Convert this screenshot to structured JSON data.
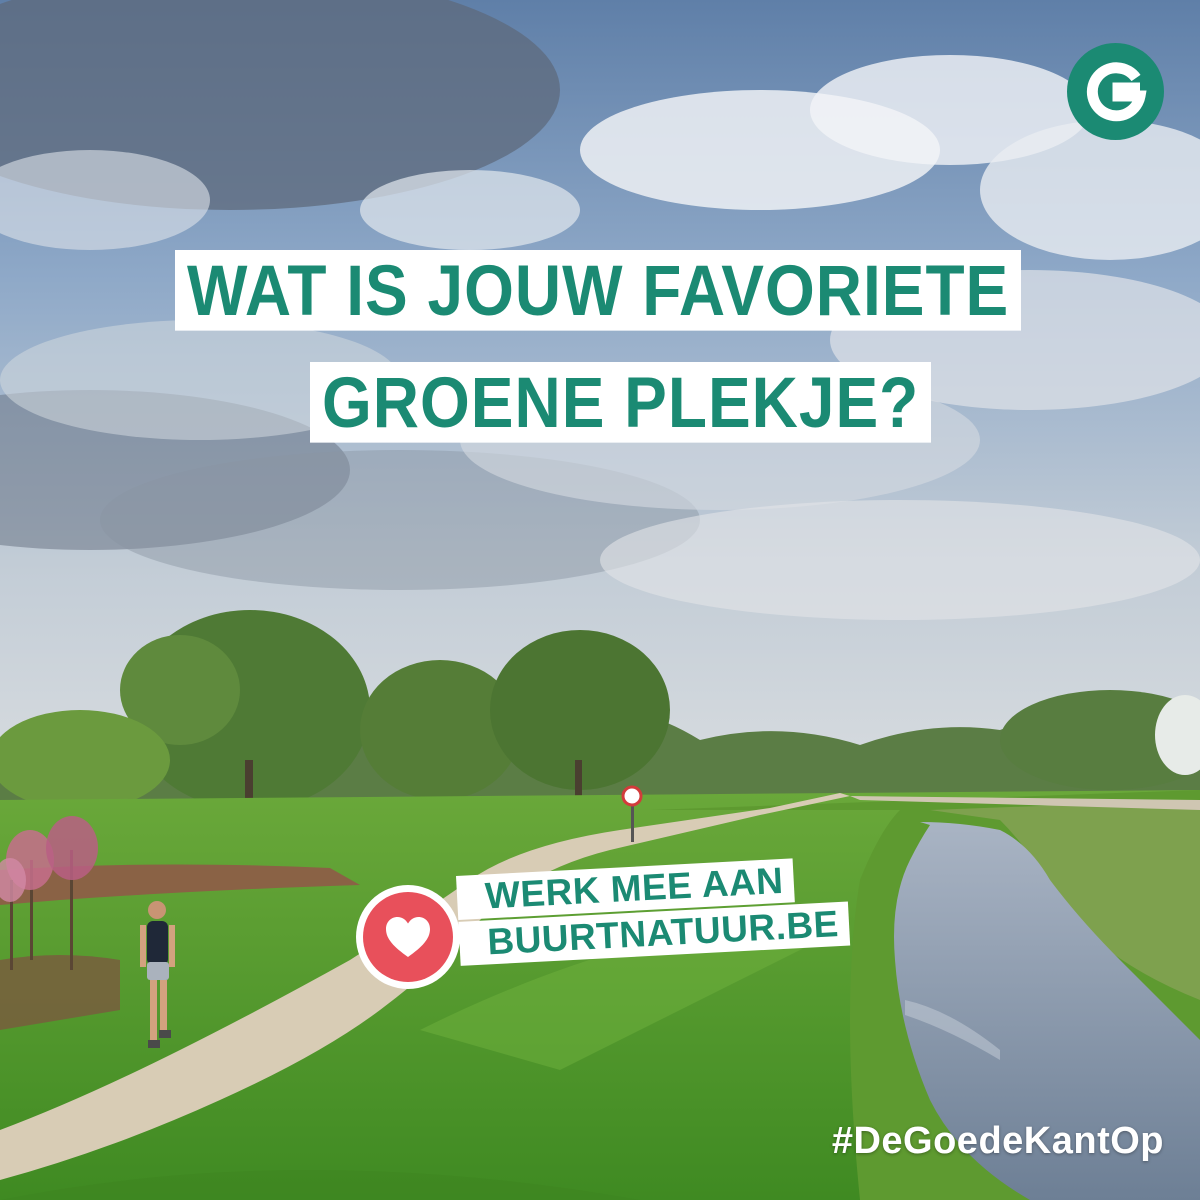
{
  "headline": {
    "line1": "WAT IS JOUW FAVORIETE",
    "line2": "GROENE PLEKJE?"
  },
  "call_to_action": {
    "line1": "WERK MEE AAN",
    "line2": "BUURTNATUUR.BE",
    "icon": "heart-icon"
  },
  "hashtag": "#DeGoedeKantOp",
  "logo": {
    "letter": "G"
  },
  "colors": {
    "brand_green": "#1b8a73",
    "heart_red": "#e8505b",
    "label_background": "#ffffff"
  }
}
